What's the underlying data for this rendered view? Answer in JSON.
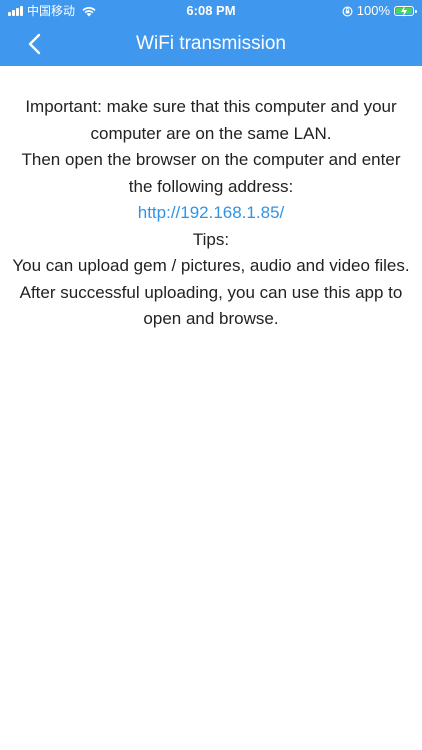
{
  "status_bar": {
    "carrier": "中国移动",
    "time": "6:08 PM",
    "battery_percent": "100%",
    "battery_level": 1.0,
    "icons": [
      "signal-icon",
      "wifi-icon",
      "orientation-lock-icon",
      "battery-charging-icon"
    ]
  },
  "nav": {
    "back_icon": "chevron-left-icon",
    "title": "WiFi transmission"
  },
  "content": {
    "important_text": "Important: make sure that this computer and your computer are on the same LAN.",
    "instruction_text": "Then open the browser on the computer and enter the following address:",
    "address_link": "http://192.168.1.85/",
    "tips_heading": "Tips:",
    "tips_text": "You can upload gem / pictures, audio and video files. After successful uploading, you can use this app to open and browse."
  },
  "colors": {
    "header_bg": "#3f97ee",
    "link": "#3193e6",
    "body_text": "#222222",
    "battery_fill": "#49d360"
  }
}
